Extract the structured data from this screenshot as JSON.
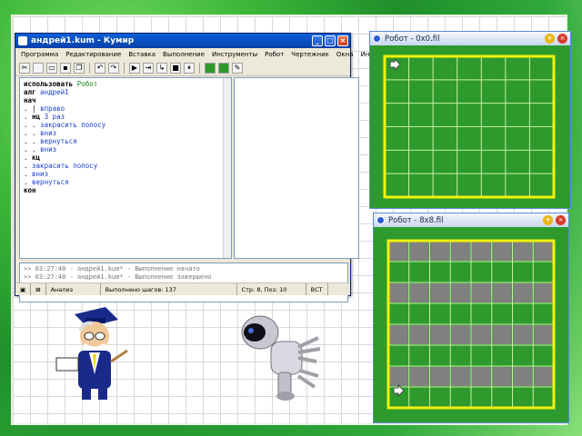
{
  "editor_window": {
    "title": "андрей1.kum - Кумир",
    "menu": [
      "Программа",
      "Редактирование",
      "Вставка",
      "Выполнение",
      "Инструменты",
      "Робот",
      "Чертежник",
      "Окна",
      "Инфо"
    ],
    "code_lines": [
      {
        "indent": "",
        "kw": "использовать",
        "rest": " Робот",
        "cls": "gn"
      },
      {
        "indent": "",
        "kw": "алг",
        "rest": " андрей1",
        "cls": "bl"
      },
      {
        "indent": "",
        "kw": "нач",
        "rest": "",
        "cls": ""
      },
      {
        "indent": ". | ",
        "kw": "",
        "rest": "вправо",
        "cls": "bl"
      },
      {
        "indent": ". ",
        "kw": "нц",
        "rest": " 3 раз",
        "cls": "bl"
      },
      {
        "indent": ". . ",
        "kw": "",
        "rest": "закрасить полосу",
        "cls": "bl"
      },
      {
        "indent": ". . ",
        "kw": "",
        "rest": "вниз",
        "cls": "bl"
      },
      {
        "indent": ". . ",
        "kw": "",
        "rest": "вернуться",
        "cls": "bl"
      },
      {
        "indent": ". . ",
        "kw": "",
        "rest": "вниз",
        "cls": "bl"
      },
      {
        "indent": ". ",
        "kw": "кц",
        "rest": "",
        "cls": ""
      },
      {
        "indent": ". ",
        "kw": "",
        "rest": "закрасить полосу",
        "cls": "bl"
      },
      {
        "indent": ". ",
        "kw": "",
        "rest": "вниз",
        "cls": "bl"
      },
      {
        "indent": ". ",
        "kw": "",
        "rest": "вернуться",
        "cls": "bl"
      },
      {
        "indent": "",
        "kw": "кон",
        "rest": "",
        "cls": ""
      }
    ],
    "output_lines": [
      ">> 03:27:40 - андрей1.kum* - Выполнение начато",
      ">> 03:27:40 - андрей1.kum* - Выполнение завершено"
    ],
    "status": {
      "mode": "Анализ",
      "steps": "Выполнено шагов: 137",
      "position": "Стр: 8, Поз: 10",
      "insert": "ВСТ"
    }
  },
  "robot_window_1": {
    "title": "Робот - 0x0.fil",
    "cols": 7,
    "rows": 6,
    "painted_rows": []
  },
  "robot_window_2": {
    "title": "Робот - 8x8.fil",
    "cols": 8,
    "rows": 8,
    "painted_rows": [
      0,
      2,
      4,
      6
    ]
  },
  "colors": {
    "robot_field": "#2e9a2e",
    "wall": "#f2f20a",
    "painted": "#808080",
    "title_active": "#0a5fd8"
  }
}
